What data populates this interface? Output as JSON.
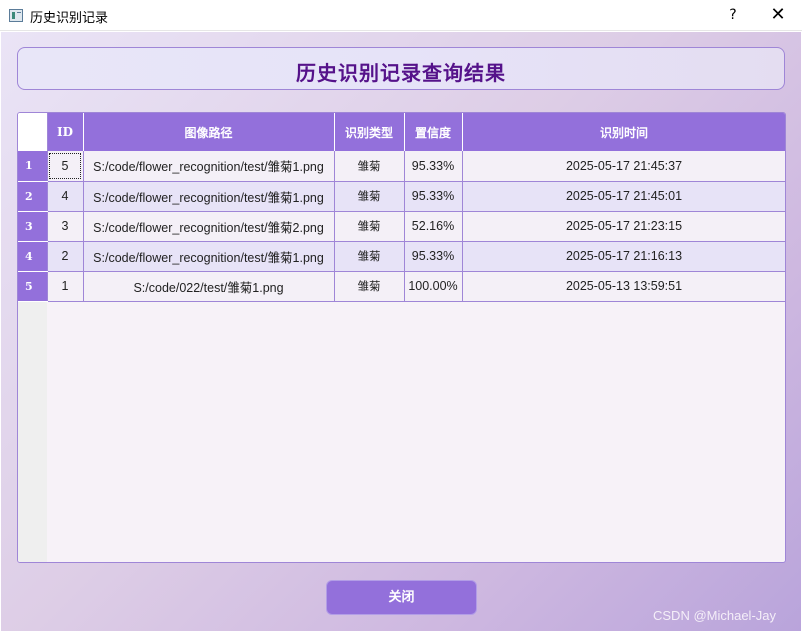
{
  "window": {
    "title": "历史识别记录",
    "help": "?",
    "close": "✕"
  },
  "header": {
    "title": "历史识别记录查询结果"
  },
  "table": {
    "columns": [
      "ID",
      "图像路径",
      "识别类型",
      "置信度",
      "识别时间"
    ],
    "rows": [
      {
        "row": "1",
        "id": "5",
        "path": "S:/code/flower_recognition/test/雏菊1.png",
        "type": "雏菊",
        "confidence": "95.33%",
        "time": "2025-05-17 21:45:37"
      },
      {
        "row": "2",
        "id": "4",
        "path": "S:/code/flower_recognition/test/雏菊1.png",
        "type": "雏菊",
        "confidence": "95.33%",
        "time": "2025-05-17 21:45:01"
      },
      {
        "row": "3",
        "id": "3",
        "path": "S:/code/flower_recognition/test/雏菊2.png",
        "type": "雏菊",
        "confidence": "52.16%",
        "time": "2025-05-17 21:23:15"
      },
      {
        "row": "4",
        "id": "2",
        "path": "S:/code/flower_recognition/test/雏菊1.png",
        "type": "雏菊",
        "confidence": "95.33%",
        "time": "2025-05-17 21:16:13"
      },
      {
        "row": "5",
        "id": "1",
        "path": "S:/code/022/test/雏菊1.png",
        "type": "雏菊",
        "confidence": "100.00%",
        "time": "2025-05-13 13:59:51"
      }
    ]
  },
  "footer": {
    "close_label": "关闭",
    "watermark": "CSDN @Michael-Jay"
  },
  "colors": {
    "accent": "#9370db",
    "title_text": "#55128a"
  }
}
